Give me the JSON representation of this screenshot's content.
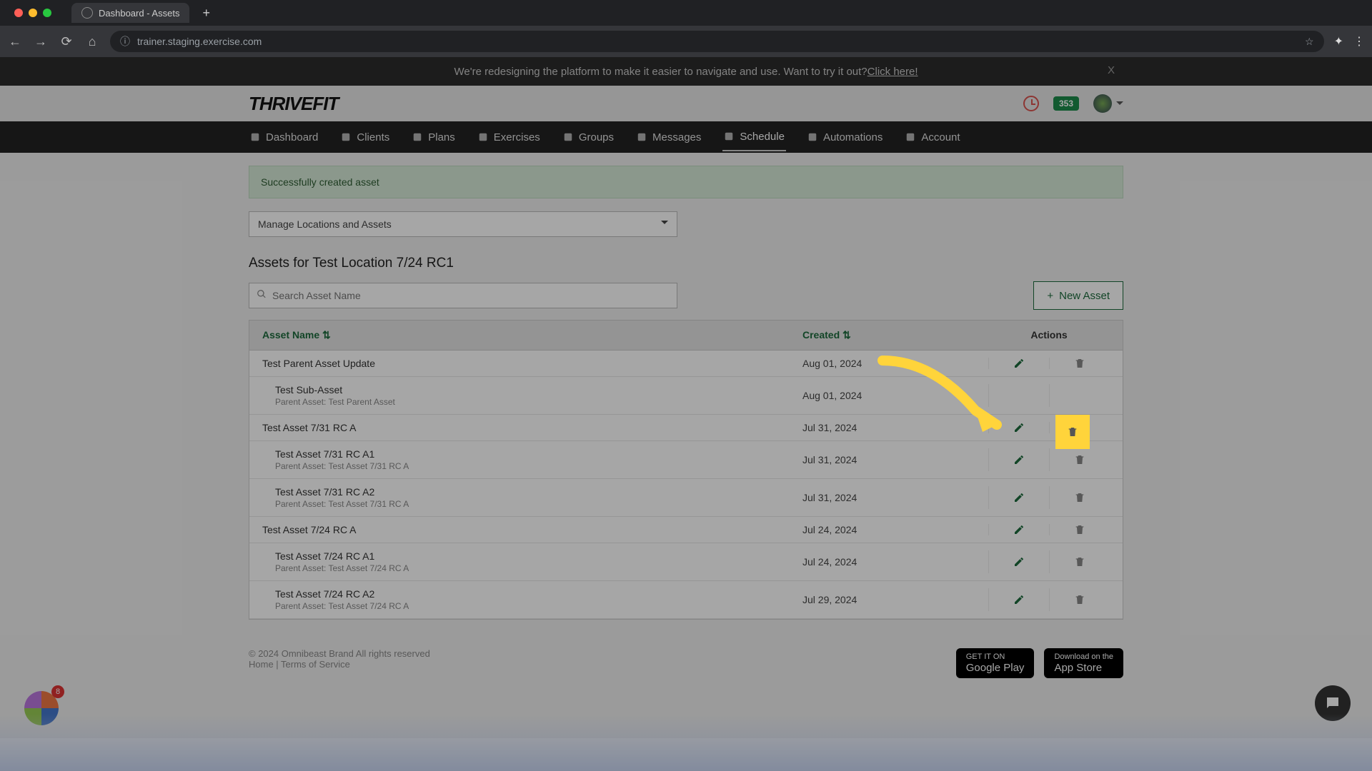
{
  "browser": {
    "tab_title": "Dashboard - Assets",
    "url": "trainer.staging.exercise.com"
  },
  "banner": {
    "text_prefix": "We're redesigning the platform to make it easier to navigate and use. Want to try it out? ",
    "link": "Click here!",
    "close": "X"
  },
  "header": {
    "brand": "THRIVEFIT",
    "badge": "353"
  },
  "nav": {
    "items": [
      {
        "label": "Dashboard"
      },
      {
        "label": "Clients"
      },
      {
        "label": "Plans"
      },
      {
        "label": "Exercises"
      },
      {
        "label": "Groups"
      },
      {
        "label": "Messages"
      },
      {
        "label": "Schedule",
        "active": true
      },
      {
        "label": "Automations"
      },
      {
        "label": "Account"
      }
    ]
  },
  "alert": "Successfully created asset",
  "dropdown": "Manage Locations and Assets",
  "page_title": "Assets for Test Location 7/24 RC1",
  "search": {
    "placeholder": "Search Asset Name"
  },
  "new_asset_btn": "New Asset",
  "table": {
    "headers": {
      "name": "Asset Name",
      "created": "Created",
      "actions": "Actions"
    },
    "rows": [
      {
        "name": "Test Parent Asset Update",
        "parent": null,
        "date": "Aug 01, 2024",
        "sub": false,
        "edit": true,
        "del": true
      },
      {
        "name": "Test Sub-Asset",
        "parent": "Parent Asset: Test Parent Asset",
        "date": "Aug 01, 2024",
        "sub": true,
        "edit": false,
        "del": true,
        "highlight_del": true
      },
      {
        "name": "Test Asset 7/31 RC A",
        "parent": null,
        "date": "Jul 31, 2024",
        "sub": false,
        "edit": true,
        "del": true
      },
      {
        "name": "Test Asset 7/31 RC A1",
        "parent": "Parent Asset: Test Asset 7/31 RC A",
        "date": "Jul 31, 2024",
        "sub": true,
        "edit": true,
        "del": true
      },
      {
        "name": "Test Asset 7/31 RC A2",
        "parent": "Parent Asset: Test Asset 7/31 RC A",
        "date": "Jul 31, 2024",
        "sub": true,
        "edit": true,
        "del": true
      },
      {
        "name": "Test Asset 7/24 RC A",
        "parent": null,
        "date": "Jul 24, 2024",
        "sub": false,
        "edit": true,
        "del": true
      },
      {
        "name": "Test Asset 7/24 RC A1",
        "parent": "Parent Asset: Test Asset 7/24 RC A",
        "date": "Jul 24, 2024",
        "sub": true,
        "edit": true,
        "del": true
      },
      {
        "name": "Test Asset 7/24 RC A2",
        "parent": "Parent Asset: Test Asset 7/24 RC A",
        "date": "Jul 29, 2024",
        "sub": true,
        "edit": true,
        "del": true
      }
    ]
  },
  "footer": {
    "copyright": "© 2024 Omnibeast Brand All rights reserved",
    "links": "Home | Terms of Service",
    "google_small": "GET IT ON",
    "google_big": "Google Play",
    "apple_small": "Download on the",
    "apple_big": "App Store"
  },
  "colorwheel_badge": "8"
}
